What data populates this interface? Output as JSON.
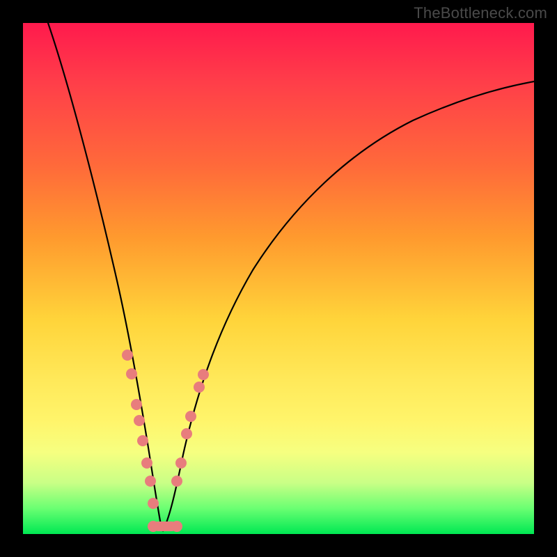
{
  "watermark": "TheBottleneck.com",
  "colors": {
    "frame": "#000000",
    "gradient_top": "#ff1a4d",
    "gradient_bottom": "#00e853",
    "curve": "#000000",
    "dots": "#e87d7d"
  },
  "chart_data": {
    "type": "line",
    "title": "",
    "xlabel": "",
    "ylabel": "",
    "xlim": [
      0,
      100
    ],
    "ylim": [
      0,
      100
    ],
    "note": "Axes unlabeled; values estimated from pixel position. y=0 at bottom (green), y=100 at top (red). Minimum ≈ x=27.",
    "series": [
      {
        "name": "bottleneck-curve",
        "x": [
          5,
          10,
          15,
          18,
          20,
          22,
          24,
          25,
          26,
          27,
          28,
          29,
          30,
          32,
          34,
          36,
          40,
          45,
          50,
          55,
          60,
          65,
          70,
          75,
          80,
          85,
          90,
          95,
          100
        ],
        "y": [
          100,
          83,
          63,
          49,
          39,
          29,
          18,
          12,
          6,
          0.5,
          3,
          7,
          11,
          18,
          24,
          29,
          38,
          47,
          54,
          60,
          65,
          69,
          73,
          76,
          79,
          81,
          83,
          85,
          86
        ]
      }
    ],
    "highlight_points_left": [
      {
        "x": 20.5,
        "y": 35
      },
      {
        "x": 21.3,
        "y": 31
      },
      {
        "x": 22.3,
        "y": 25
      },
      {
        "x": 22.8,
        "y": 22
      },
      {
        "x": 23.5,
        "y": 18
      },
      {
        "x": 24.2,
        "y": 14
      },
      {
        "x": 24.8,
        "y": 10
      },
      {
        "x": 25.5,
        "y": 6
      }
    ],
    "highlight_points_right": [
      {
        "x": 30.0,
        "y": 10
      },
      {
        "x": 30.7,
        "y": 14
      },
      {
        "x": 32.0,
        "y": 20
      },
      {
        "x": 32.7,
        "y": 23
      },
      {
        "x": 34.5,
        "y": 29
      },
      {
        "x": 35.3,
        "y": 31
      }
    ],
    "bottom_bar": {
      "x_start": 25.5,
      "x_end": 30.0,
      "y": 0.7
    }
  }
}
